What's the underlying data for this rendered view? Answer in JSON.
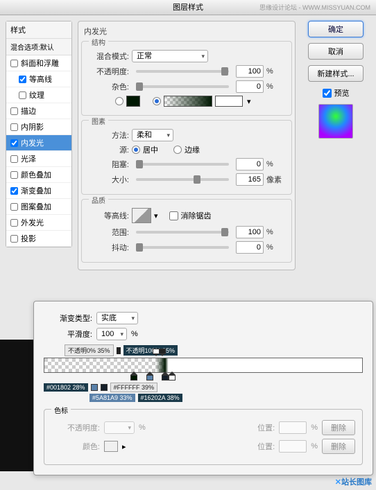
{
  "title": "图层样式",
  "watermark": "思缘设计论坛 - WWW.MISSYUAN.COM",
  "left": {
    "header": "样式",
    "subheader": "混合选项:默认",
    "items": [
      {
        "label": "斜面和浮雕",
        "checked": false
      },
      {
        "label": "等高线",
        "checked": true,
        "indent": true
      },
      {
        "label": "纹理",
        "checked": false,
        "indent": true
      },
      {
        "label": "描边",
        "checked": false
      },
      {
        "label": "内阴影",
        "checked": false
      },
      {
        "label": "内发光",
        "checked": true,
        "selected": true
      },
      {
        "label": "光泽",
        "checked": false
      },
      {
        "label": "颜色叠加",
        "checked": false
      },
      {
        "label": "渐变叠加",
        "checked": true
      },
      {
        "label": "图案叠加",
        "checked": false
      },
      {
        "label": "外发光",
        "checked": false
      },
      {
        "label": "投影",
        "checked": false
      }
    ]
  },
  "panel": {
    "title": "内发光",
    "structure": {
      "legend": "结构",
      "blend_label": "混合模式:",
      "blend_value": "正常",
      "opacity_label": "不透明度:",
      "opacity_value": "100",
      "opacity_unit": "%",
      "noise_label": "杂色:",
      "noise_value": "0",
      "noise_unit": "%",
      "solid_color": "#001802"
    },
    "element": {
      "legend": "图素",
      "tech_label": "方法:",
      "tech_value": "柔和",
      "source_label": "源:",
      "source_center": "居中",
      "source_edge": "边缘",
      "choke_label": "阻塞:",
      "choke_value": "0",
      "choke_unit": "%",
      "size_label": "大小:",
      "size_value": "165",
      "size_unit": "像素"
    },
    "quality": {
      "legend": "品质",
      "contour_label": "等高线:",
      "aa_label": "消除锯齿",
      "range_label": "范围:",
      "range_value": "100",
      "range_unit": "%",
      "jitter_label": "抖动:",
      "jitter_value": "0",
      "jitter_unit": "%"
    }
  },
  "right": {
    "ok": "确定",
    "cancel": "取消",
    "newstyle": "新建样式...",
    "preview": "预览"
  },
  "grad": {
    "type_label": "渐变类型:",
    "type_value": "实底",
    "smooth_label": "平滑度:",
    "smooth_value": "100",
    "smooth_unit": "%",
    "op_stop1": "不透明0% 35%",
    "op_stop2": "不透明100% 35%",
    "c_stop1": "#001802 28%",
    "c_stop2": "#5A81A9 33%",
    "c_stop3": "#16202A 38%",
    "c_stop4": "#FFFFFF 39%",
    "stops_legend": "色标",
    "opacity_label": "不透明度:",
    "pos1_label": "位置:",
    "del1": "删除",
    "color_label": "颜色:",
    "pos2_label": "位置:",
    "del2": "删除"
  },
  "footer": "站长图库"
}
